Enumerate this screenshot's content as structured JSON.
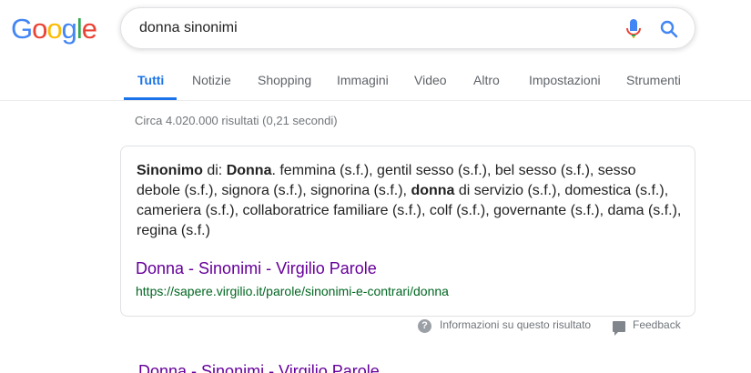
{
  "logo": {
    "letters": [
      "G",
      "o",
      "o",
      "g",
      "l",
      "e"
    ],
    "colors": [
      "#4285F4",
      "#EA4335",
      "#FBBC05",
      "#4285F4",
      "#34A853",
      "#EA4335"
    ]
  },
  "search": {
    "query": "donna sinonimi",
    "mic_icon": "mic-icon",
    "search_icon": "search-icon"
  },
  "tabs": [
    {
      "label": "Tutti",
      "active": true
    },
    {
      "label": "Notizie"
    },
    {
      "label": "Shopping"
    },
    {
      "label": "Immagini"
    },
    {
      "label": "Video"
    },
    {
      "label": "Altro"
    },
    {
      "label": "Impostazioni"
    },
    {
      "label": "Strumenti"
    }
  ],
  "stats": "Circa 4.020.000 risultati (0,21 secondi)",
  "featured": {
    "bold_term": "Sinonimo",
    "prefix": " di: ",
    "bold_word": "Donna",
    "text_part1": ". femmina (s.f.), gentil sesso (s.f.), bel sesso (s.f.), sesso debole (s.f.), signora (s.f.), signorina (s.f.), ",
    "bold_inline": "donna",
    "text_part2": " di servizio (s.f.), domestica (s.f.), cameriera (s.f.), collaboratrice familiare (s.f.), colf (s.f.), governante (s.f.), dama (s.f.), regina (s.f.)",
    "title": "Donna - Sinonimi - Virgilio Parole",
    "url": "https://sapere.virgilio.it/parole/sinonimi-e-contrari/donna"
  },
  "footer": {
    "info": "Informazioni su questo risultato",
    "feedback": "Feedback"
  },
  "next_result": {
    "title": "Donna - Sinonimi - Virgilio Parole"
  },
  "colors": {
    "accent": "#1a73e8",
    "visited": "#660099",
    "url_green": "#006621"
  }
}
